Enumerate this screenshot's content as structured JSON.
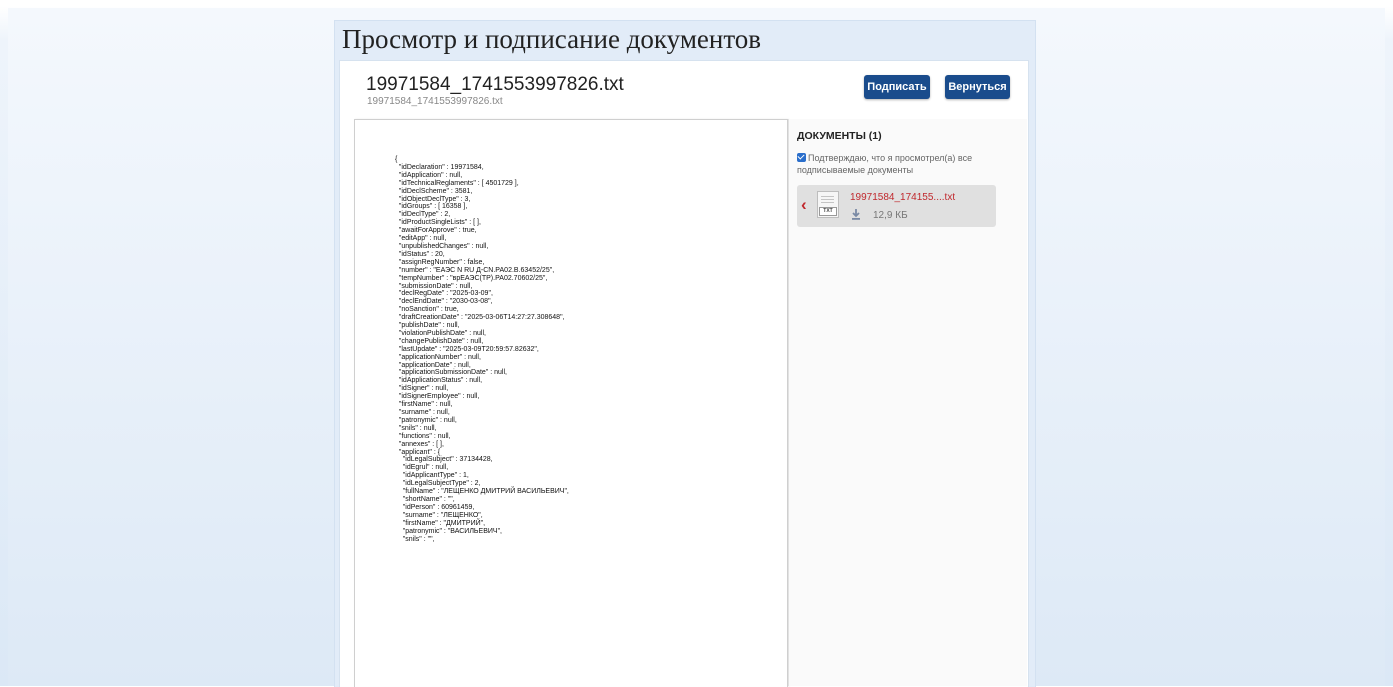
{
  "page": {
    "title": "Просмотр и подписание документов"
  },
  "document": {
    "title": "19971584_1741553997826.txt",
    "subtitle": "19971584_1741553997826.txt",
    "content_lines": [
      "{",
      "  \"idDeclaration\" : 19971584,",
      "  \"idApplication\" : null,",
      "  \"idTechnicalReglaments\" : [ 4501729 ],",
      "  \"idDeclScheme\" : 3581,",
      "  \"idObjectDeclType\" : 3,",
      "  \"idGroups\" : [ 16358 ],",
      "  \"idDeclType\" : 2,",
      "  \"idProductSingleLists\" : [ ],",
      "  \"awaitForApprove\" : true,",
      "  \"editApp\" : null,",
      "  \"unpublishedChanges\" : null,",
      "  \"idStatus\" : 20,",
      "  \"assignRegNumber\" : false,",
      "  \"number\" : \"ЕАЭС N RU Д-CN.РА02.В.63452/25\",",
      "  \"tempNumber\" : \"врЕАЭС(ТР).РА02.70602/25\",",
      "  \"submissionDate\" : null,",
      "  \"declRegDate\" : \"2025-03-09\",",
      "  \"declEndDate\" : \"2030-03-08\",",
      "  \"noSanction\" : true,",
      "  \"draftCreationDate\" : \"2025-03-06T14:27:27.308648\",",
      "  \"publishDate\" : null,",
      "  \"violationPublishDate\" : null,",
      "  \"changePublishDate\" : null,",
      "  \"lastUpdate\" : \"2025-03-09T20:59:57.82632\",",
      "  \"applicationNumber\" : null,",
      "  \"applicationDate\" : null,",
      "  \"applicationSubmissionDate\" : null,",
      "  \"idApplicationStatus\" : null,",
      "  \"idSigner\" : null,",
      "  \"idSignerEmployee\" : null,",
      "  \"firstName\" : null,",
      "  \"surname\" : null,",
      "  \"patronymic\" : null,",
      "  \"snils\" : null,",
      "  \"functions\" : null,",
      "  \"annexes\" : [ ],",
      "  \"applicant\" : {",
      "    \"idLegalSubject\" : 37134428,",
      "    \"idEgrul\" : null,",
      "    \"idApplicantType\" : 1,",
      "    \"idLegalSubjectType\" : 2,",
      "    \"fullName\" : \"ЛЕЩЕНКО ДМИТРИЙ ВАСИЛЬЕВИЧ\",",
      "    \"shortName\" : \"\",",
      "    \"idPerson\" : 60961459,",
      "    \"surname\" : \"ЛЕЩЕНКО\",",
      "    \"firstName\" : \"ДМИТРИЙ\",",
      "    \"patronymic\" : \"ВАСИЛЬЕВИЧ\",",
      "    \"snils\" : \"\","
    ]
  },
  "actions": {
    "sign_label": "Подписать",
    "back_label": "Вернуться"
  },
  "sidebar": {
    "header": "ДОКУМЕНТЫ (1)",
    "confirm_checked": true,
    "confirm_text": "Подтверждаю, что я просмотрел(а) все подписываемые документы",
    "files": [
      {
        "name": "19971584_174155....txt",
        "size": "12,9 КБ",
        "type_tag": "TXT",
        "icon": "txt-file-icon",
        "download_icon": "download-icon",
        "collapse_icon": "chevron-left-icon"
      }
    ]
  },
  "colors": {
    "primary_button": "#1a4c8c",
    "file_link": "#c0282d",
    "checkbox": "#2a6ecb",
    "panel_bg": "#e2ecf8"
  }
}
